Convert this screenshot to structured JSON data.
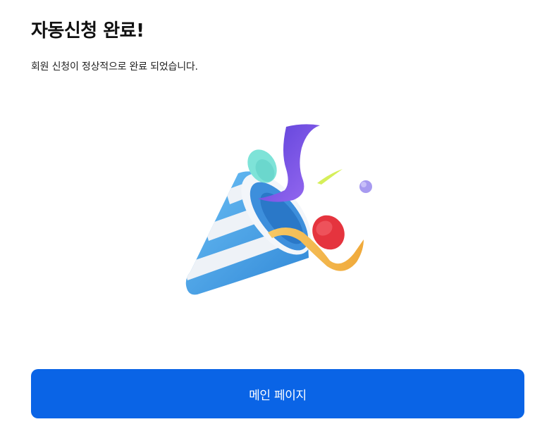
{
  "header": {
    "title": "자동신청 완료!",
    "message": "회원 신청이 정상적으로 완료 되었습니다."
  },
  "illustration": {
    "icon": "party-popper-icon",
    "colors": {
      "cone_blue": "#4aa8ea",
      "cone_white": "#eef2f7",
      "ribbon_purple": "#7b4fe0",
      "ribbon_yellow": "#f3b94a",
      "confetti_mint": "#7ee3d8",
      "confetti_red": "#e5343e",
      "confetti_lavender": "#a79af0",
      "confetti_lime": "#d6ef5a"
    }
  },
  "actions": {
    "main_page_label": "메인 페이지",
    "accent_color": "#0a64e6"
  }
}
